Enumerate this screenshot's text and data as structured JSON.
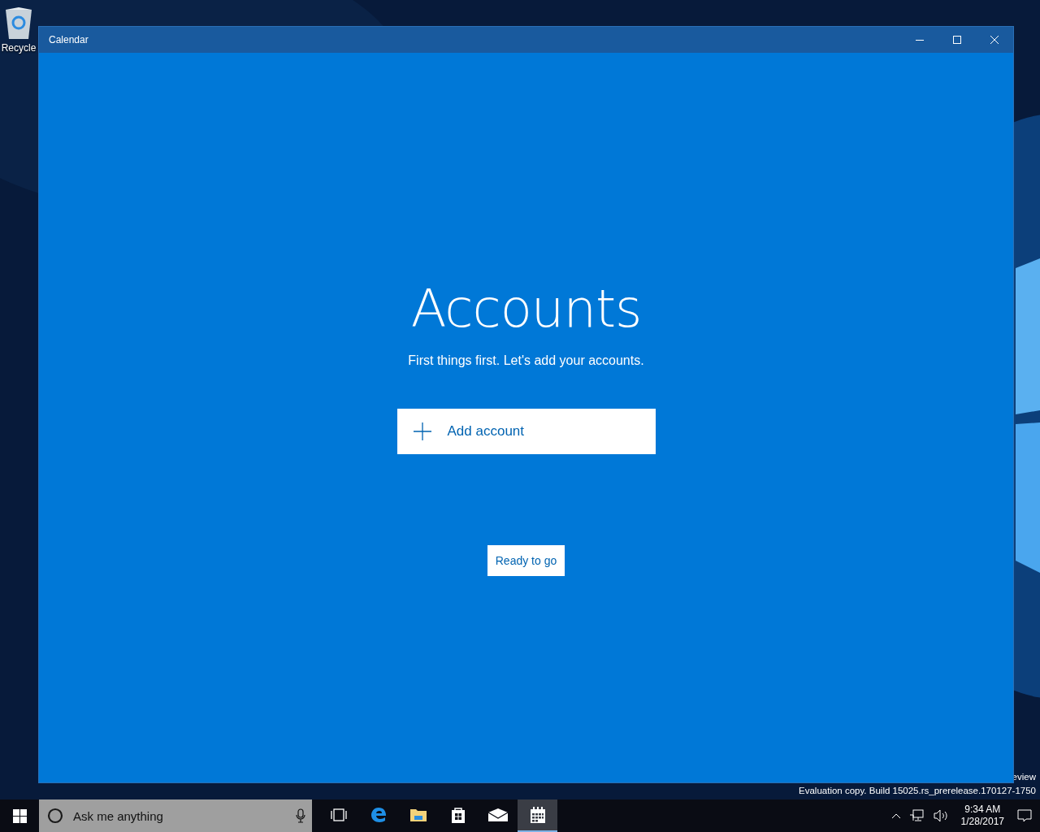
{
  "desktop": {
    "icons": [
      {
        "label": "Recycle"
      }
    ],
    "edition_text": "eview",
    "build_text": "Evaluation copy. Build 15025.rs_prerelease.170127-1750"
  },
  "window": {
    "title": "Calendar",
    "heading": "Accounts",
    "subtitle": "First things first. Let's add your accounts.",
    "add_button": "Add account",
    "ready_button": "Ready to go"
  },
  "taskbar": {
    "search": {
      "placeholder": "Ask me anything"
    },
    "apps": [
      {
        "kind": "taskview",
        "selected": false
      },
      {
        "kind": "edge",
        "selected": false
      },
      {
        "kind": "explorer",
        "selected": false
      },
      {
        "kind": "store",
        "selected": false
      },
      {
        "kind": "mail",
        "selected": false
      },
      {
        "kind": "calendar",
        "selected": true
      }
    ],
    "time": "9:34 AM",
    "date": "1/28/2017"
  }
}
